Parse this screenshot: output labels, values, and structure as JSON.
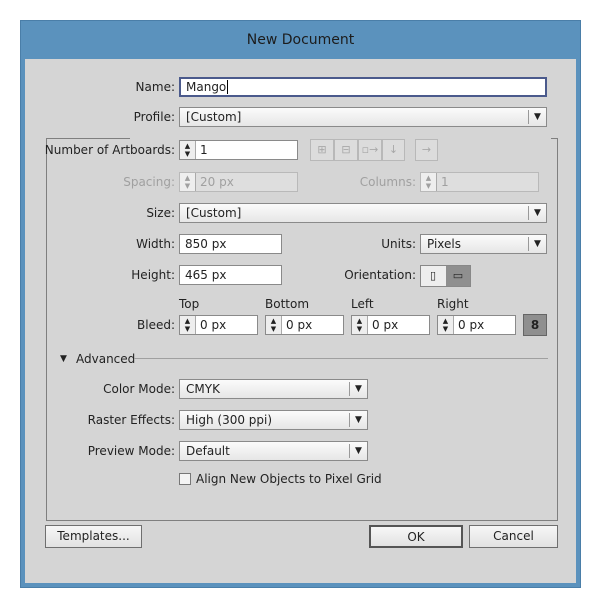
{
  "window": {
    "title": "New Document"
  },
  "name": {
    "label": "Name:",
    "value": "Mango"
  },
  "profile": {
    "label": "Profile:",
    "value": "[Custom]"
  },
  "artboards": {
    "label": "Number of Artboards:",
    "value": "1",
    "arrange_icons": [
      "grid-by-row-icon",
      "grid-by-column-icon",
      "arrange-by-row-icon",
      "arrange-by-column-icon",
      "right-to-left-icon"
    ]
  },
  "spacing": {
    "label": "Spacing:",
    "value": "20 px"
  },
  "columns": {
    "label": "Columns:",
    "value": "1"
  },
  "size": {
    "label": "Size:",
    "value": "[Custom]"
  },
  "width": {
    "label": "Width:",
    "value": "850 px"
  },
  "units": {
    "label": "Units:",
    "value": "Pixels"
  },
  "height": {
    "label": "Height:",
    "value": "465 px"
  },
  "orientation": {
    "label": "Orientation:",
    "selected": "landscape"
  },
  "bleed": {
    "label": "Bleed:",
    "top_label": "Top",
    "bottom_label": "Bottom",
    "left_label": "Left",
    "right_label": "Right",
    "top": "0 px",
    "bottom": "0 px",
    "left": "0 px",
    "right": "0 px"
  },
  "advanced": {
    "label": "Advanced"
  },
  "color_mode": {
    "label": "Color Mode:",
    "value": "CMYK"
  },
  "raster": {
    "label": "Raster Effects:",
    "value": "High (300 ppi)"
  },
  "preview": {
    "label": "Preview Mode:",
    "value": "Default"
  },
  "pixel_grid": {
    "label": "Align New Objects to Pixel Grid",
    "checked": false
  },
  "buttons": {
    "templates": "Templates...",
    "ok": "OK",
    "cancel": "Cancel"
  }
}
